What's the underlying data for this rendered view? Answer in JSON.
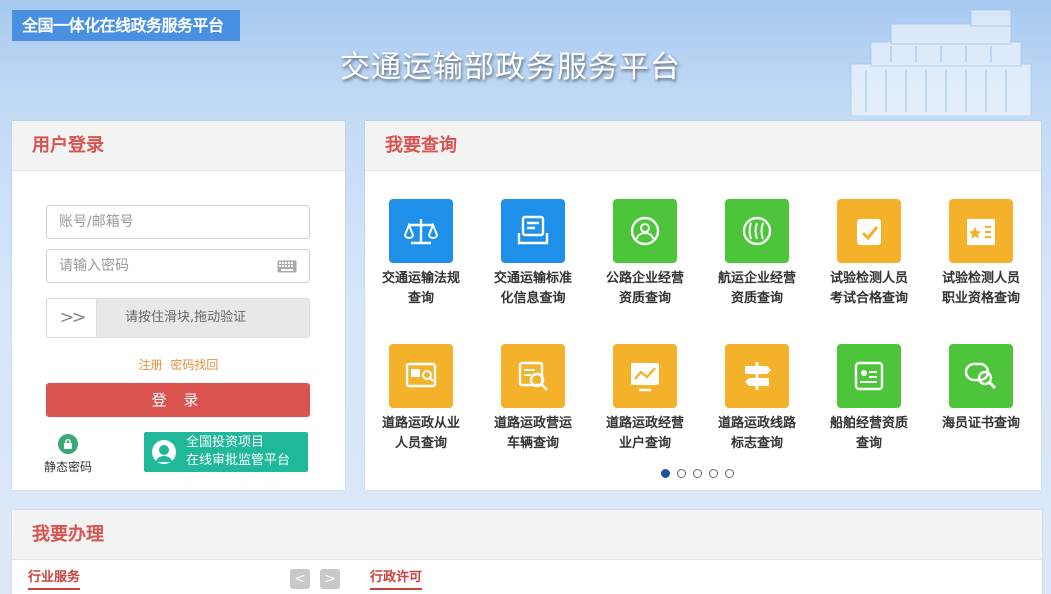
{
  "header": {
    "badge": "全国一体化在线政务服务平台",
    "title": "交通运输部政务服务平台"
  },
  "login": {
    "title": "用户登录",
    "username_placeholder": "账号/邮箱号",
    "password_placeholder": "请输入密码",
    "slider_handle": ">>",
    "slider_text": "请按住滑块,拖动验证",
    "register": "注册",
    "forgot": "密码找回",
    "login_button": "登 录",
    "static_password": "静态密码",
    "invest_line1": "全国投资项目",
    "invest_line2": "在线审批监管平台"
  },
  "query": {
    "title": "我要查询",
    "items": [
      {
        "line1": "交通运输法规",
        "line2": "查询",
        "color": "#1e90ea",
        "icon": "scales-icon"
      },
      {
        "line1": "交通运输标准",
        "line2": "化信息查询",
        "color": "#1e90ea",
        "icon": "document-tray-icon"
      },
      {
        "line1": "公路企业经营",
        "line2": "资质查询",
        "color": "#4cc53a",
        "icon": "person-search-icon"
      },
      {
        "line1": "航运企业经营",
        "line2": "资质查询",
        "color": "#4cc53a",
        "icon": "wave-search-icon"
      },
      {
        "line1": "试验检测人员",
        "line2": "考试合格查询",
        "color": "#f4b22a",
        "icon": "clipboard-check-icon"
      },
      {
        "line1": "试验检测人员",
        "line2": "职业资格查询",
        "color": "#f4b22a",
        "icon": "certificate-book-icon"
      },
      {
        "line1": "道路运政从业",
        "line2": "人员查询",
        "color": "#f4b22a",
        "icon": "id-card-search-icon"
      },
      {
        "line1": "道路运政营运",
        "line2": "车辆查询",
        "color": "#f4b22a",
        "icon": "vehicle-search-icon"
      },
      {
        "line1": "道路运政经营",
        "line2": "业户查询",
        "color": "#f4b22a",
        "icon": "chart-board-icon"
      },
      {
        "line1": "道路运政线路",
        "line2": "标志查询",
        "color": "#f4b22a",
        "icon": "signpost-icon"
      },
      {
        "line1": "船舶经营资质",
        "line2": "查询",
        "color": "#4cc53a",
        "icon": "ship-card-icon"
      },
      {
        "line1": "海员证书查询",
        "line2": "",
        "color": "#4cc53a",
        "icon": "certificate-search-icon"
      }
    ],
    "pages": 5,
    "active_page": 1
  },
  "handle": {
    "title": "我要办理",
    "tab_left": "行业服务",
    "tab_right": "行政许可",
    "prev": "<",
    "next": ">"
  }
}
